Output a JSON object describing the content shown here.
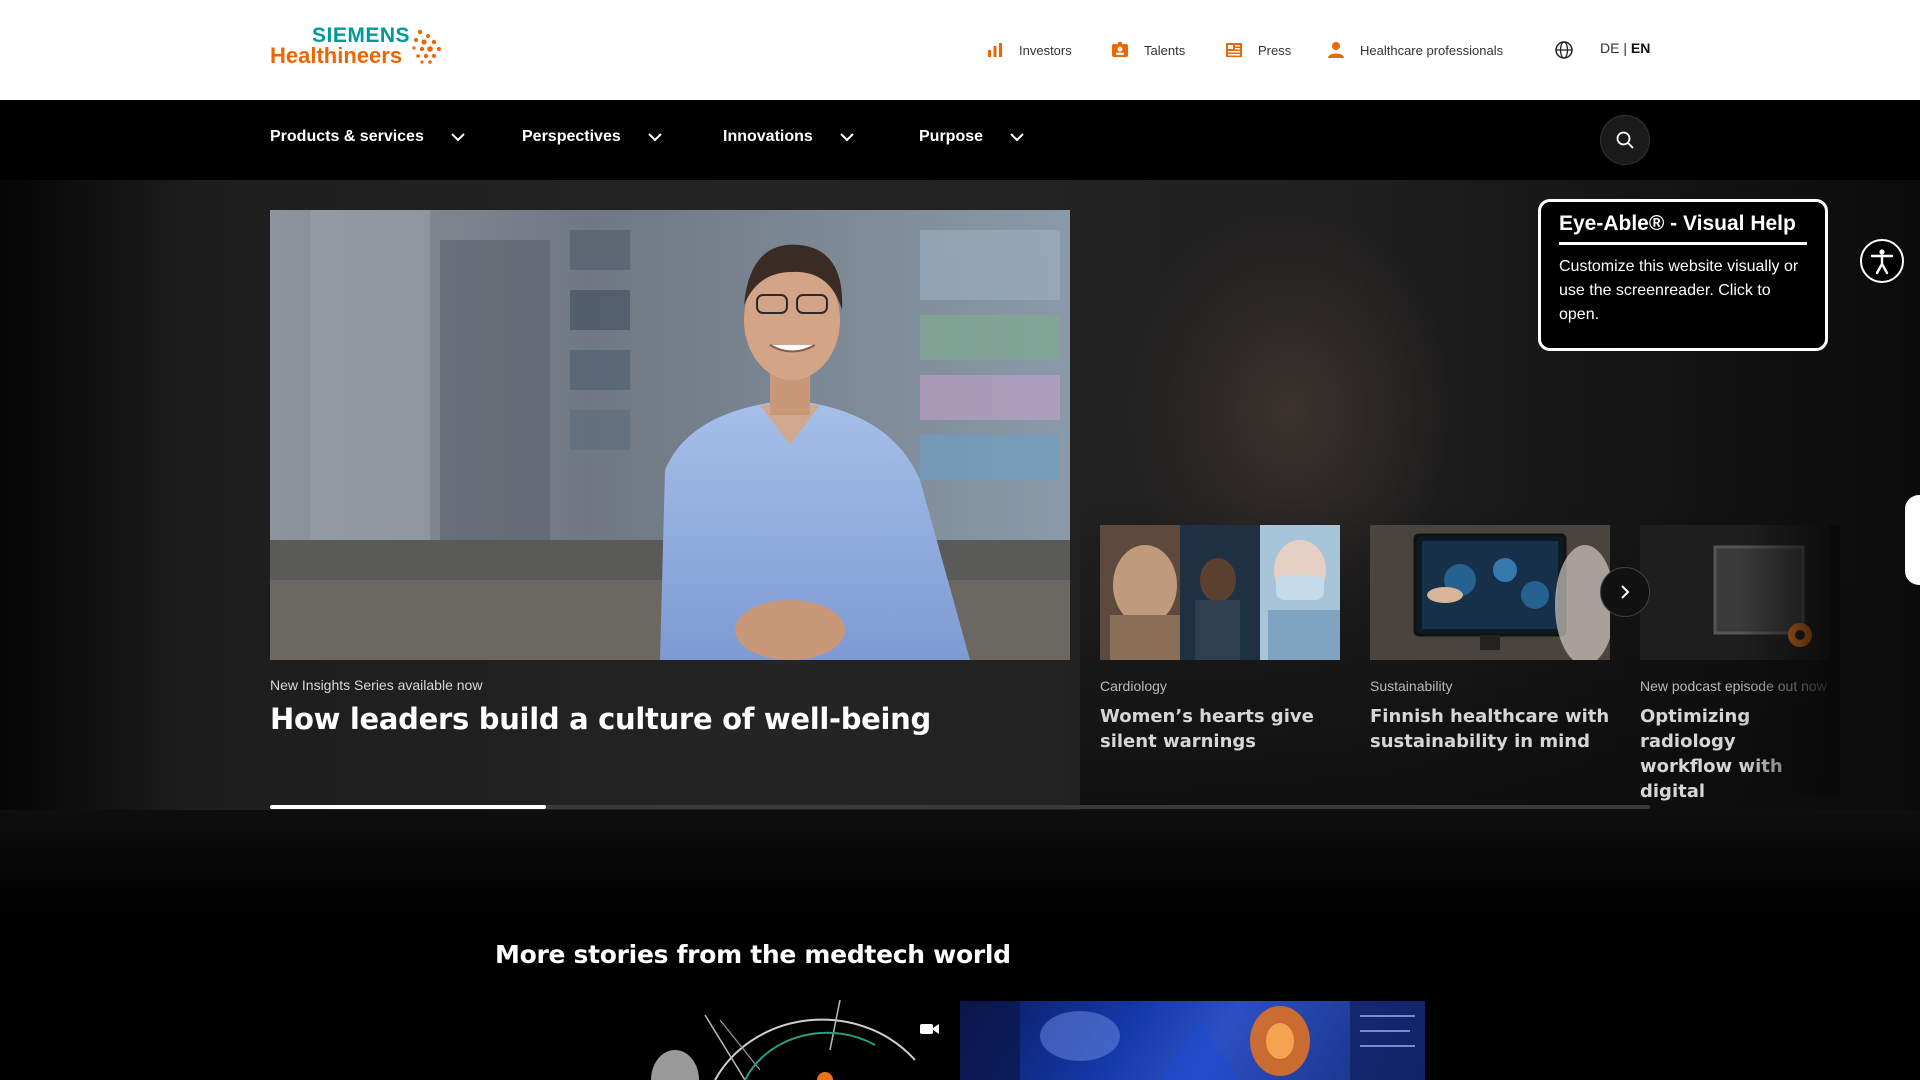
{
  "header": {
    "logo": {
      "line1": "SIEMENS",
      "line2": "Healthineers"
    },
    "utility_links": [
      {
        "label": "Investors",
        "icon": "bar-chart-icon"
      },
      {
        "label": "Talents",
        "icon": "badge-icon"
      },
      {
        "label": "Press",
        "icon": "newspaper-icon"
      },
      {
        "label": "Healthcare professionals",
        "icon": "person-icon"
      }
    ],
    "language": {
      "de": "DE",
      "separator": " | ",
      "en": "EN",
      "active": "EN"
    }
  },
  "nav": {
    "items": [
      {
        "label": "Products & services"
      },
      {
        "label": "Perspectives"
      },
      {
        "label": "Innovations"
      },
      {
        "label": "Purpose"
      }
    ]
  },
  "hero": {
    "main": {
      "tag": "New Insights Series available now",
      "title": "How leaders build a culture of well-being"
    },
    "cards": [
      {
        "tag": "Cardiology",
        "title": "Women’s hearts give silent warnings"
      },
      {
        "tag": "Sustainability",
        "title": "Finnish healthcare with sustainability in mind"
      },
      {
        "tag": "New podcast episode out now",
        "title": "Optimizing radiology workflow with digital"
      }
    ],
    "progress_fraction": 0.2
  },
  "eyeable": {
    "title": "Eye-Able® - Visual Help",
    "body": "Customize this website visually or use the screenreader. Click to open."
  },
  "more_stories": {
    "title": "More stories from the medtech world"
  },
  "colors": {
    "brand_teal": "#009999",
    "brand_orange": "#ec6602",
    "accent_orange": "#e8731c"
  }
}
